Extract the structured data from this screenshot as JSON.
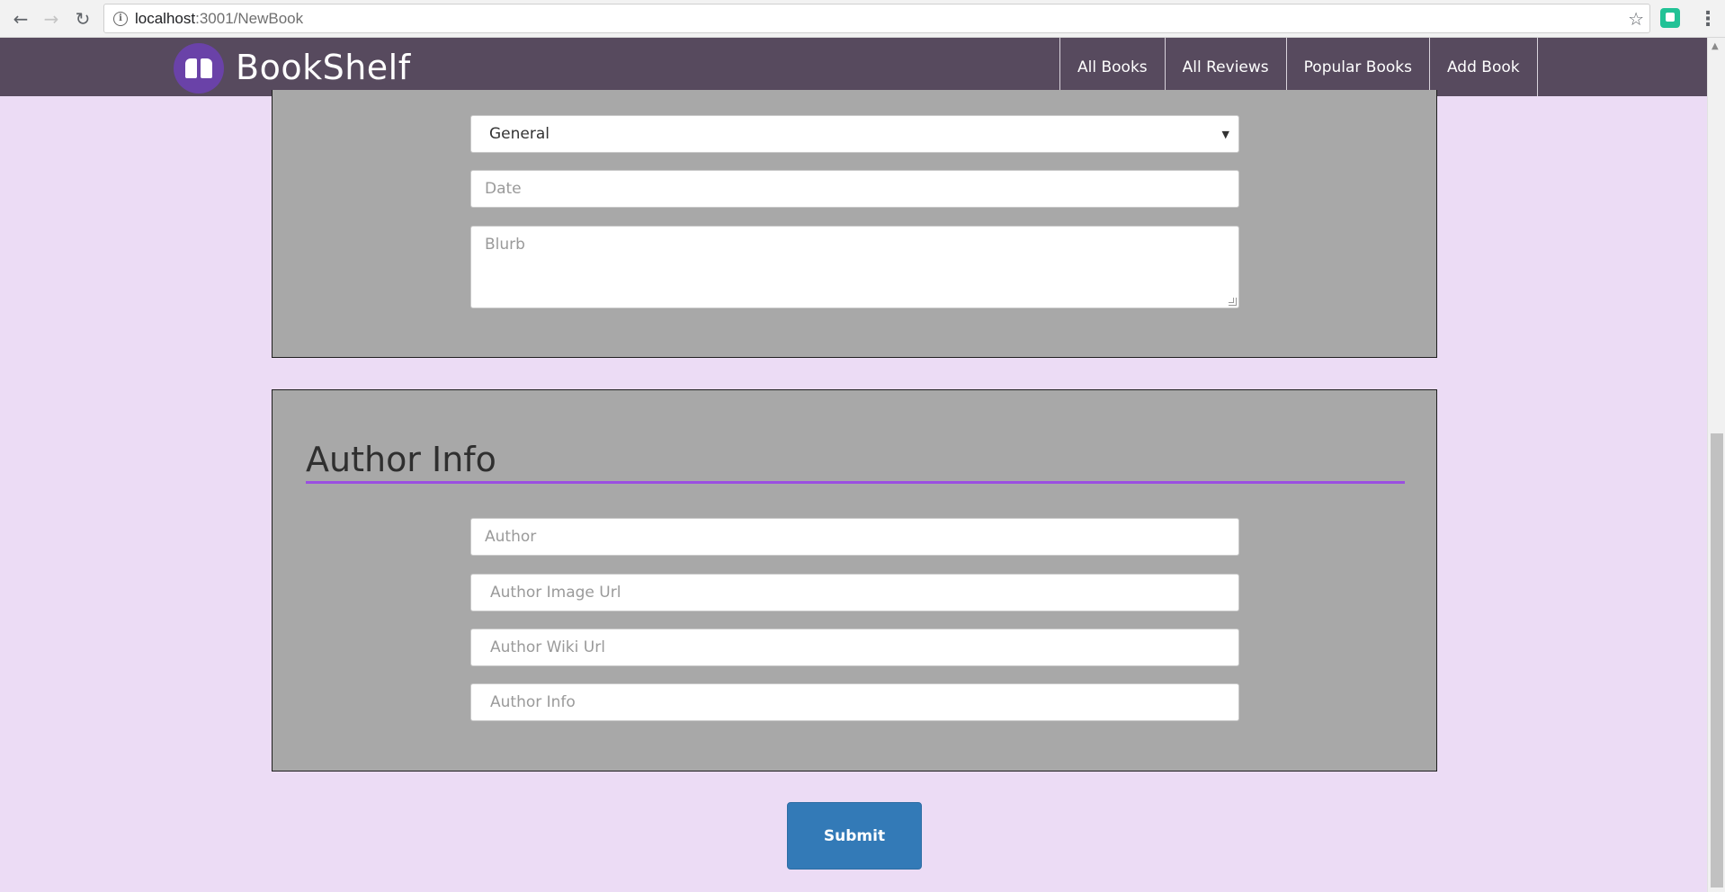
{
  "browser": {
    "url_host": "localhost",
    "url_path": ":3001/NewBook",
    "back_icon": "arrow-left-icon",
    "forward_icon": "arrow-right-icon",
    "reload_icon": "reload-icon",
    "info_icon": "info-icon",
    "star_icon": "star-icon",
    "menu_icon": "kebab-menu-icon"
  },
  "navbar": {
    "brand": "BookShelf",
    "logo_icon": "book-icon",
    "links": [
      {
        "label": "All Books"
      },
      {
        "label": "All Reviews"
      },
      {
        "label": "Popular Books"
      },
      {
        "label": "Add Book"
      }
    ],
    "background": "#574a5e",
    "logo_color": "#6a42a8"
  },
  "book_section": {
    "genre_select": {
      "value": "General"
    },
    "date_field": {
      "placeholder": "Date"
    },
    "blurb_field": {
      "placeholder": "Blurb"
    }
  },
  "author_section": {
    "title": "Author Info",
    "rule_color": "#9a4fe0",
    "fields": {
      "author": {
        "placeholder": "Author"
      },
      "image_url": {
        "placeholder": "Author Image Url"
      },
      "wiki_url": {
        "placeholder": "Author Wiki Url"
      },
      "info": {
        "placeholder": "Author Info"
      }
    }
  },
  "submit": {
    "label": "Submit",
    "color": "#337ab7"
  },
  "page_background": "#ecdcf5",
  "panel_background": "#a8a8a8"
}
